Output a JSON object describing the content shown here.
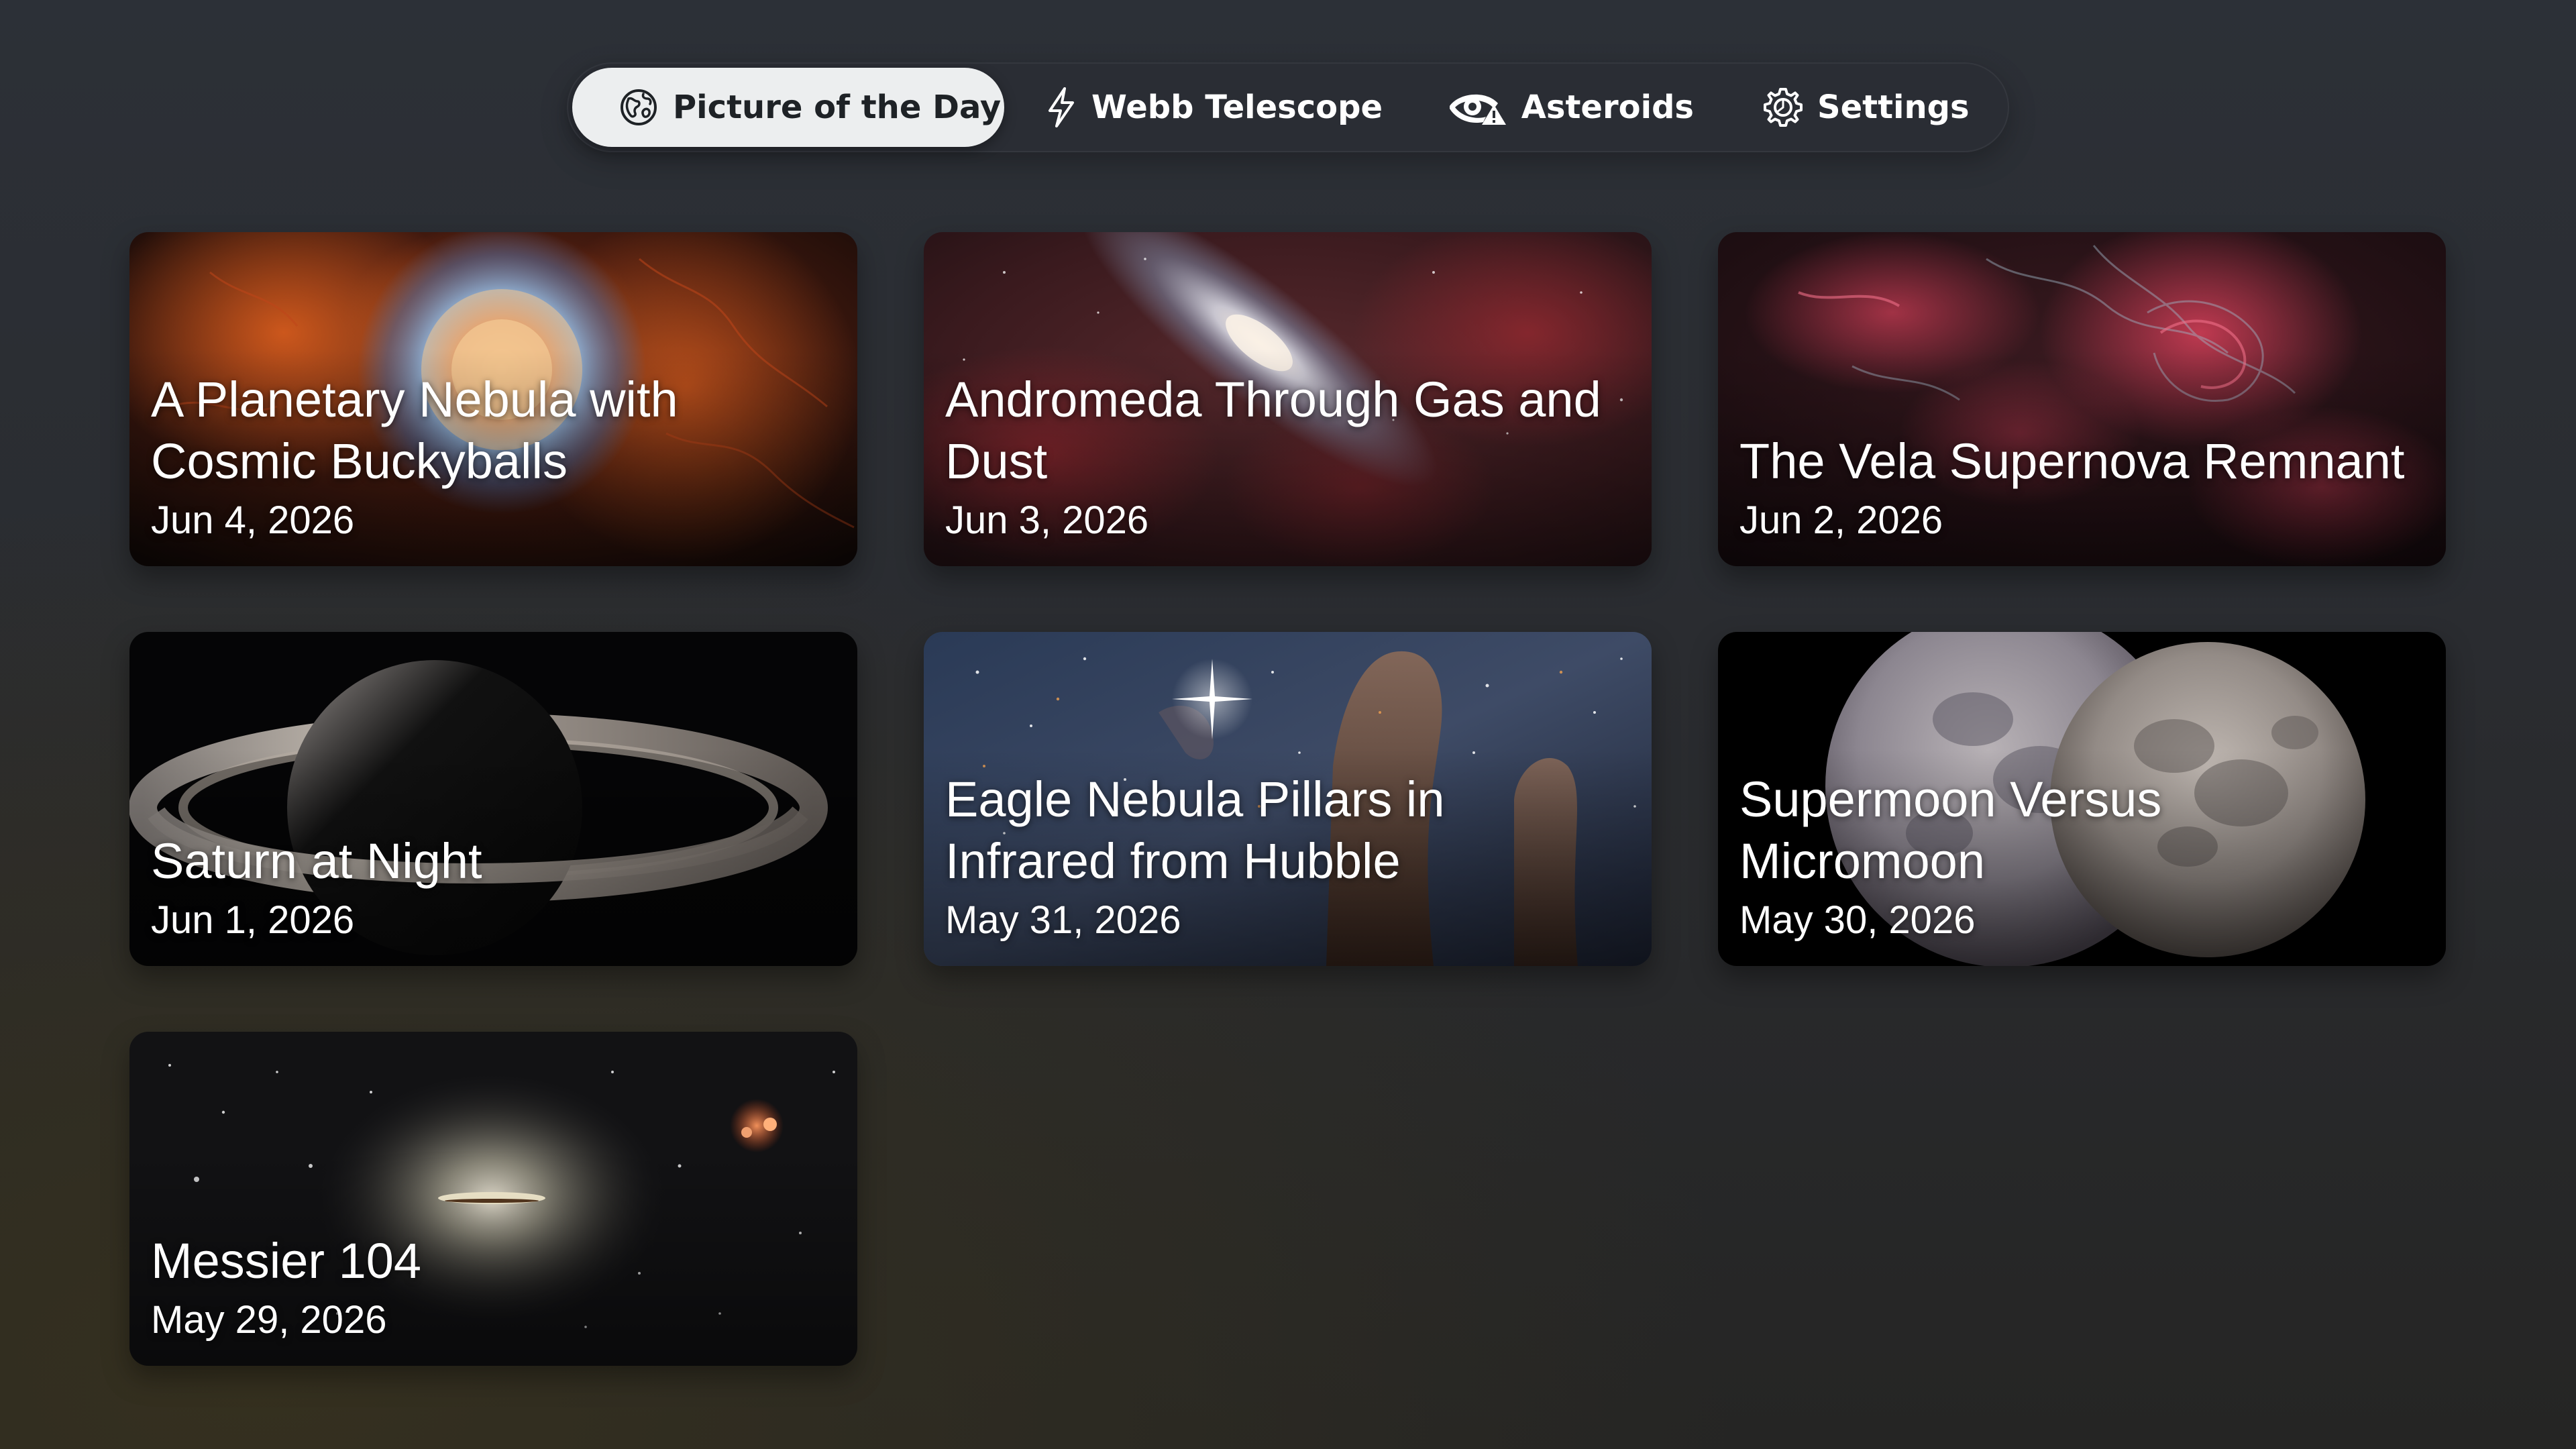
{
  "tabs": [
    {
      "label": "Picture of the Day",
      "icon": "globe-icon",
      "active": true
    },
    {
      "label": "Webb Telescope",
      "icon": "bolt-icon",
      "active": false
    },
    {
      "label": "Asteroids",
      "icon": "eye-warning-icon",
      "active": false
    },
    {
      "label": "Settings",
      "icon": "gear-icon",
      "active": false
    }
  ],
  "cards": [
    {
      "title": "A Planetary Nebula with Cosmic Buckyballs",
      "date": "Jun 4, 2026"
    },
    {
      "title": "Andromeda Through Gas and Dust",
      "date": "Jun 3, 2026"
    },
    {
      "title": "The Vela Supernova Remnant",
      "date": "Jun 2, 2026"
    },
    {
      "title": "Saturn at Night",
      "date": "Jun 1, 2026"
    },
    {
      "title": "Eagle Nebula Pillars in Infrared from Hubble",
      "date": "May 31, 2026"
    },
    {
      "title": "Supermoon Versus Micromoon",
      "date": "May 30, 2026"
    },
    {
      "title": "Messier 104",
      "date": "May 29, 2026"
    }
  ],
  "colors": {
    "background": "#2a2d32",
    "tab_active_bg": "#eceeef",
    "tab_active_text": "#1e2226",
    "text": "#ffffff"
  }
}
